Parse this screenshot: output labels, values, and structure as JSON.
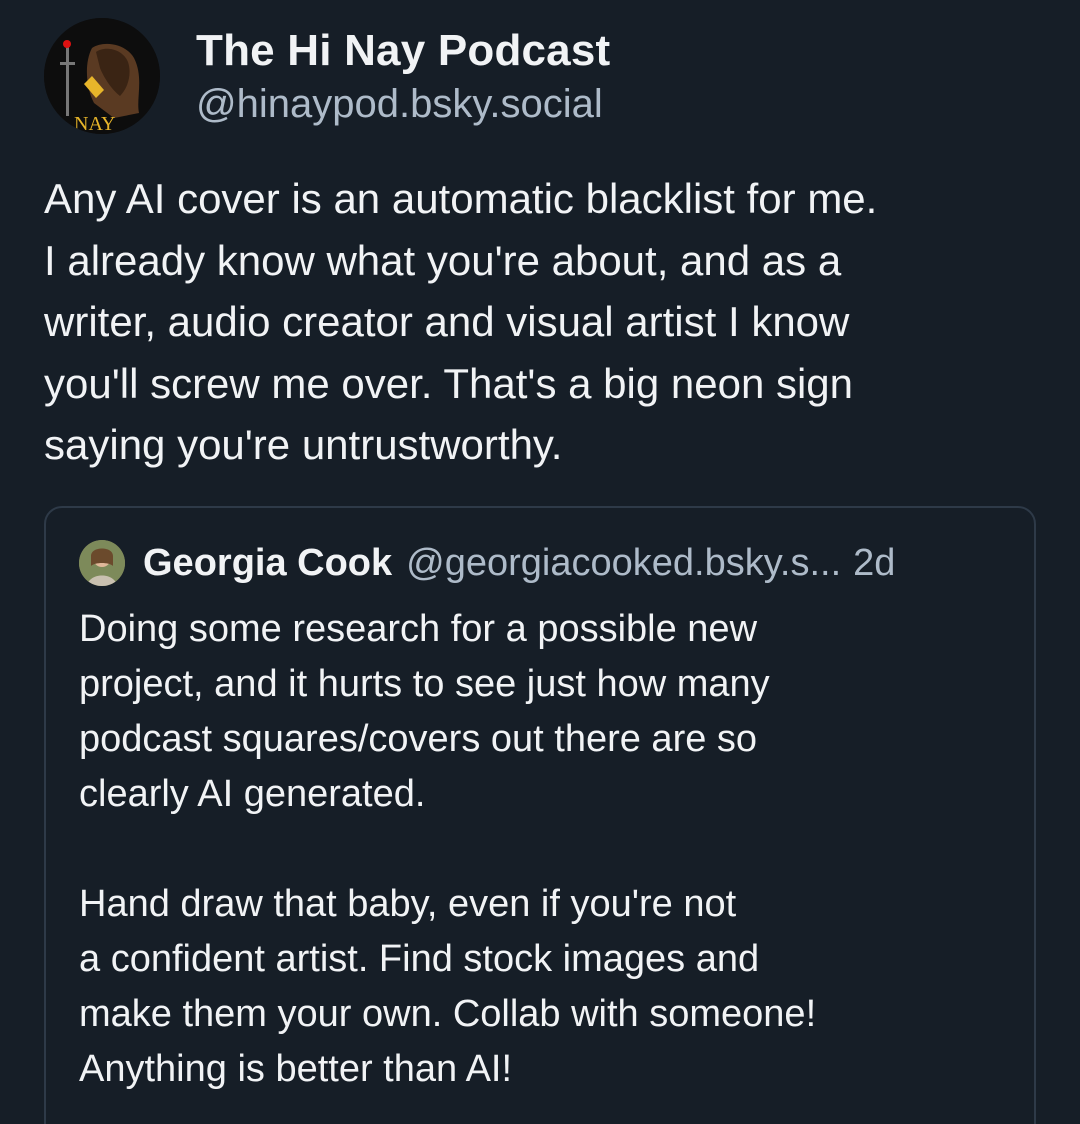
{
  "post": {
    "author": {
      "display_name": "The Hi Nay Podcast",
      "handle": "@hinaypod.bsky.social",
      "avatar_icon": "podcast-logo-avatar",
      "avatar_text": "NAY"
    },
    "body_lines": [
      "Any AI cover is an automatic blacklist for me.",
      "I already know what you're about, and as a",
      "writer, audio creator and visual artist I know",
      "you'll screw me over. That's a big neon sign",
      "saying you're untrustworthy."
    ]
  },
  "quote": {
    "author": {
      "display_name": "Georgia Cook",
      "handle": "@georgiacooked.bsky.s...",
      "avatar_icon": "user-avatar"
    },
    "time": "2d",
    "paragraph1": [
      "Doing some research for a possible new",
      "project, and it hurts to see just how many",
      "podcast squares/covers out there are so",
      "clearly AI generated."
    ],
    "paragraph2": [
      "Hand draw that baby, even if you're not",
      "a confident artist. Find stock images and",
      "make them your own. Collab with someone!",
      "Anything is better than AI!"
    ]
  },
  "colors": {
    "background": "#161e27",
    "text_primary": "#f1f3f5",
    "text_secondary": "#aebbc9",
    "card_border": "#2e3a48"
  }
}
